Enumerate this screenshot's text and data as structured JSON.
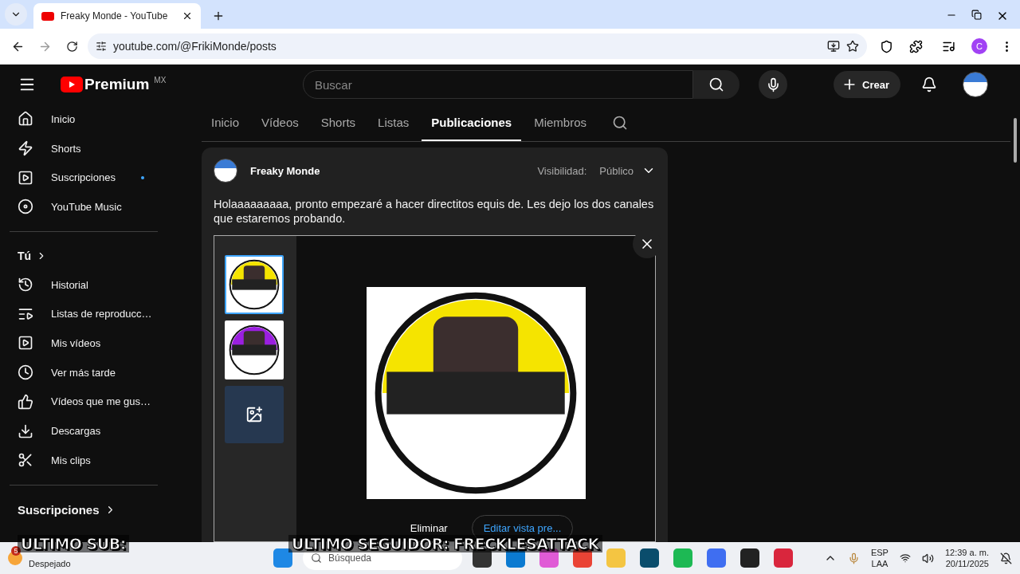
{
  "browser": {
    "tab_title": "Freaky Monde - YouTube",
    "url": "youtube.com/@FrikiMonde/posts",
    "profile_initial": "C"
  },
  "header": {
    "logo_text": "Premium",
    "region": "MX",
    "search_placeholder": "Buscar",
    "create_label": "Crear"
  },
  "sidebar": {
    "main": [
      {
        "label": "Inicio",
        "dot": false
      },
      {
        "label": "Shorts",
        "dot": false
      },
      {
        "label": "Suscripciones",
        "dot": true
      },
      {
        "label": "YouTube Music",
        "dot": false
      }
    ],
    "you_heading": "Tú",
    "you": [
      {
        "label": "Historial"
      },
      {
        "label": "Listas de reproducc…"
      },
      {
        "label": "Mis vídeos"
      },
      {
        "label": "Ver más tarde"
      },
      {
        "label": "Vídeos que me gus…"
      },
      {
        "label": "Descargas"
      },
      {
        "label": "Mis clips"
      }
    ],
    "subs_heading": "Suscripciones"
  },
  "channel_tabs": [
    {
      "label": "Inicio",
      "selected": false
    },
    {
      "label": "Vídeos",
      "selected": false
    },
    {
      "label": "Shorts",
      "selected": false
    },
    {
      "label": "Listas",
      "selected": false
    },
    {
      "label": "Publicaciones",
      "selected": true
    },
    {
      "label": "Miembros",
      "selected": false
    }
  ],
  "post": {
    "author": "Freaky Monde",
    "visibility_label": "Visibilidad:",
    "visibility_value": "Público",
    "text": "Holaaaaaaaaa, pronto empezaré a hacer directitos equis de. Les dejo los dos canales que estaremos probando.",
    "images": [
      {
        "selected": true,
        "color": "#f5e400"
      },
      {
        "selected": false,
        "color": "#9b1fe0"
      }
    ],
    "delete_label": "Eliminar",
    "edit_label": "Editar vista pre..."
  },
  "overlay": {
    "last_sub": "ULTIMO SUB:",
    "last_follower": "ULTIMO SEGUIDOR: FRECKLESATTACK"
  },
  "taskbar": {
    "weather_badge": "5",
    "weather": "Despejado",
    "search_placeholder": "Búsqueda",
    "lang_1": "ESP",
    "lang_2": "LAA",
    "time": "12:39 a. m.",
    "date": "20/11/2025"
  }
}
